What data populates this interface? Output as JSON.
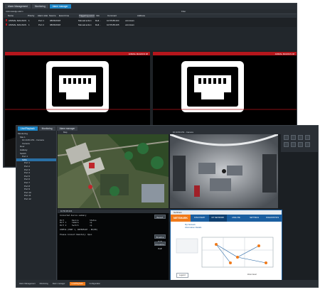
{
  "back_window": {
    "tabs": [
      "Alarm Management",
      "Monitoring",
      "Alarm manager"
    ],
    "active_tab": 2,
    "toolbar_left": "Acknowledge alarm",
    "toolbar_mid": "Filter",
    "columns": [
      "Name",
      "Priority",
      "Alarm state",
      "Source",
      "Event time",
      "Triggering event",
      "Info",
      "Comment",
      "Address"
    ],
    "rows": [
      [
        "ANIMAL MAGNUS 48",
        "1",
        "Port 1",
        "08/06/2018",
        "Manual action",
        "Dell...",
        "10.55.88.204",
        "unit down"
      ],
      [
        "ANIMAL MAGNUS 48",
        "1",
        "Port 2",
        "08/06/2018",
        "Manual action",
        "Dell...",
        "10.55.88.205",
        "unit down"
      ]
    ],
    "camera_left_title": "ANIMAL MAGNUS 48",
    "camera_right_title": "ANIMAL MAGNUS 48",
    "camera_left_icon": "ethernet-port-icon",
    "camera_right_icon": "ethernet-port-icon"
  },
  "front_window": {
    "tabs": [
      "Live/Playback",
      "Monitoring",
      "Alarm manager"
    ],
    "tree": [
      {
        "label": "Monitoring",
        "sel": false,
        "depth": 0
      },
      {
        "label": "Site 1",
        "sel": false,
        "depth": 1
      },
      {
        "label": "10.10.84.151 - Camera",
        "sel": false,
        "depth": 2
      },
      {
        "label": "Camera",
        "sel": false,
        "depth": 2
      },
      {
        "label": "Door",
        "sel": false,
        "depth": 1
      },
      {
        "label": "Hallway",
        "sel": false,
        "depth": 1
      },
      {
        "label": "Switch",
        "sel": false,
        "depth": 1
      },
      {
        "label": "Port 1",
        "sel": false,
        "depth": 2
      },
      {
        "label": "SWA",
        "sel": true,
        "depth": 2
      },
      {
        "label": "Port 1",
        "sel": false,
        "depth": 3
      },
      {
        "label": "Port 2",
        "sel": false,
        "depth": 3
      },
      {
        "label": "Port 3",
        "sel": false,
        "depth": 3
      },
      {
        "label": "Port 4",
        "sel": false,
        "depth": 3
      },
      {
        "label": "Port 5",
        "sel": false,
        "depth": 3
      },
      {
        "label": "Port 6",
        "sel": false,
        "depth": 3
      },
      {
        "label": "Port 7",
        "sel": false,
        "depth": 3
      },
      {
        "label": "Port 8",
        "sel": false,
        "depth": 3
      },
      {
        "label": "Port 9",
        "sel": false,
        "depth": 3
      },
      {
        "label": "Port 10",
        "sel": false,
        "depth": 3
      },
      {
        "label": "Port 11",
        "sel": false,
        "depth": 3
      },
      {
        "label": "Port 12",
        "sel": false,
        "depth": 3
      }
    ],
    "map_title": "Map",
    "camera_title": "10.10.84.151 - Camera",
    "terminal_title": "10.56.38.204",
    "terminal_lines": [
      "Connected device summary",
      "",
      "Port       Device          Status",
      "Port 1     Camera          up",
      "Port 2     Switch          up",
      "",
      "CONFIG (PORT 1, INTERFACE - 80/88)",
      "",
      "Please Connect Remotely: Open"
    ],
    "btn_reset": "Reset",
    "btn_enable": "Enable PoE",
    "btn_disable": "Disable PoE",
    "netshark": {
      "title": "NetShark",
      "brand": "NETSHARK",
      "nav": [
        "DISCOVERY",
        "MY NETWORK",
        "ANALYZE",
        "SETTINGS",
        "DIAGNOSTICS"
      ],
      "active_nav": 1,
      "tree_line1": "My Network",
      "tree_line2": "Information Details",
      "legend": "Legend",
      "zoom_label": "Zoom level"
    },
    "status_items": [
      "Alarm Management",
      "Monitoring",
      "Alarm manager",
      "Live/Playback",
      "Configuration"
    ]
  },
  "colors": {
    "accent_blue": "#1c86c8",
    "alarm_red": "#b5161c",
    "netshark_orange": "#f07a1a",
    "netshark_blue": "#1a5ea0"
  }
}
